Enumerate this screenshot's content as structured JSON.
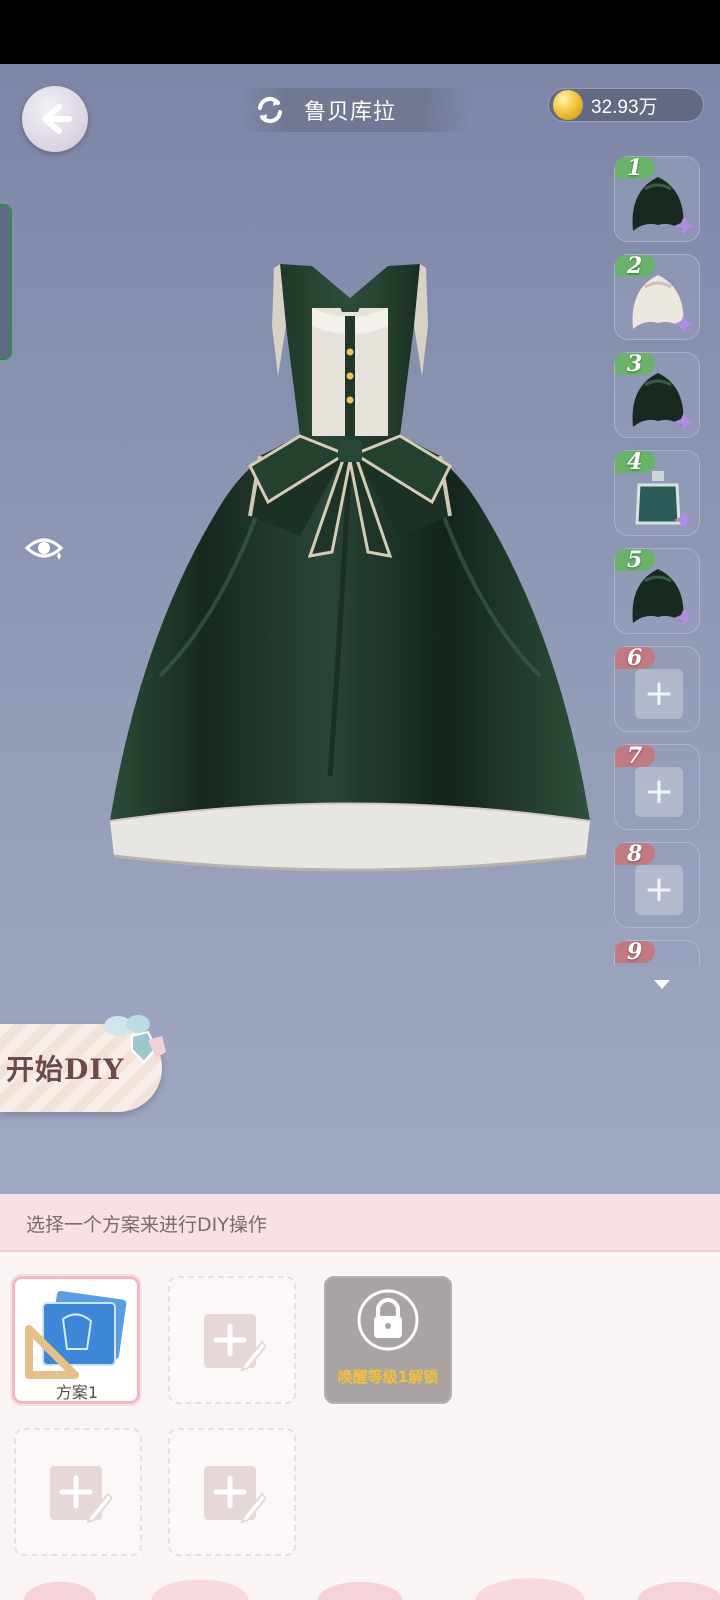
{
  "header": {
    "title": "鲁贝库拉",
    "coins": "32.93万",
    "back_icon": "back-arrow-icon",
    "switch_icon": "refresh-icon"
  },
  "slots": [
    {
      "num": "1",
      "state": "filled",
      "item": "hair-black"
    },
    {
      "num": "2",
      "state": "filled",
      "item": "hair-white"
    },
    {
      "num": "3",
      "state": "filled",
      "item": "hair-black"
    },
    {
      "num": "4",
      "state": "filled",
      "item": "dye-bottle"
    },
    {
      "num": "5",
      "state": "filled",
      "item": "hair-black"
    },
    {
      "num": "6",
      "state": "empty"
    },
    {
      "num": "7",
      "state": "empty"
    },
    {
      "num": "8",
      "state": "empty"
    },
    {
      "num": "9",
      "state": "empty"
    }
  ],
  "diy": {
    "label": "开始DIY"
  },
  "panel": {
    "hint": "选择一个方案来进行DIY操作",
    "plans": [
      {
        "label": "方案1",
        "state": "selected"
      },
      {
        "label": "",
        "state": "empty"
      },
      {
        "label": "唤醒等级1解锁",
        "state": "locked"
      },
      {
        "label": "",
        "state": "empty"
      },
      {
        "label": "",
        "state": "empty"
      }
    ]
  },
  "colors": {
    "accent_pink": "#f1b9c0",
    "slot_green": "#69b26a",
    "slot_red": "#c27a82",
    "lock_text": "#f0c23a",
    "dress_green": "#1f3529"
  }
}
